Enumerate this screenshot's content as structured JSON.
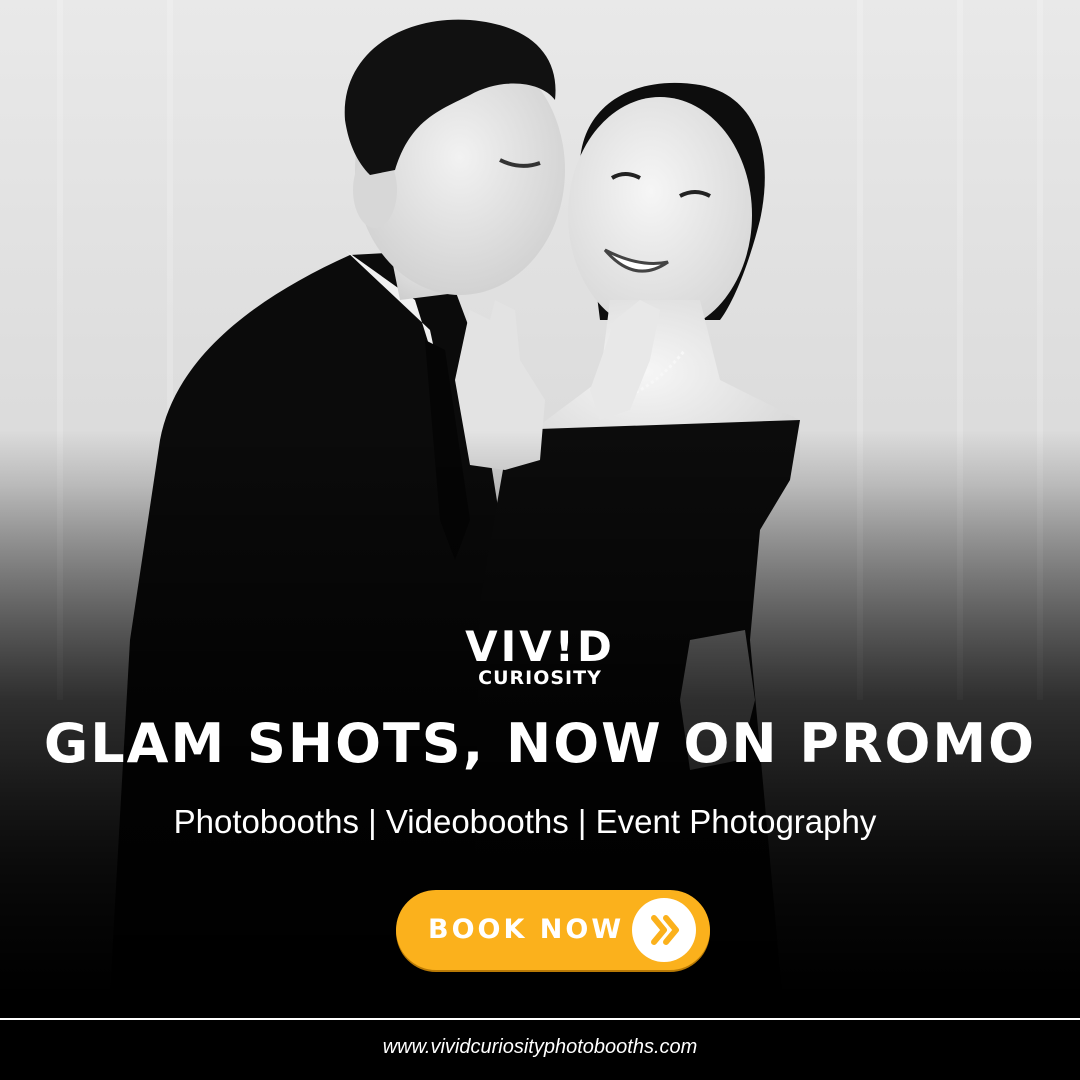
{
  "brand": {
    "logo_main": "VIV!D",
    "logo_sub": "CURIOSITY"
  },
  "headline": "GLAM SHOTS, NOW ON PROMO",
  "services": "Photobooths | Videobooths | Event Photography",
  "cta": {
    "label": "BOOK NOW",
    "icon": "double-chevron-right-icon"
  },
  "website": "www.vividcuriosityphotobooths.com",
  "colors": {
    "accent": "#FBB11C",
    "text": "#FFFFFF",
    "background": "#000000"
  }
}
